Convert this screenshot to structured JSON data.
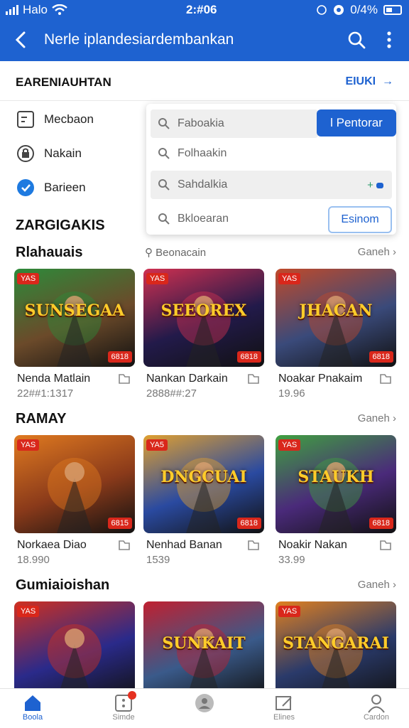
{
  "status_bar": {
    "carrier": "Halo",
    "time": "2:#06",
    "battery_text": "0/4%"
  },
  "app_bar": {
    "back_icon": "back-arrow-icon",
    "title": "Nerle iplandesiardembankan"
  },
  "section": {
    "label": "EARENIAUHTAN",
    "link": "EIUKI",
    "link_icon": "arrow-right-icon"
  },
  "side_list": [
    {
      "label": "Mecbaon",
      "icon": "document-icon"
    },
    {
      "label": "Nakain",
      "icon": "lock-icon"
    },
    {
      "label": "Barieen",
      "icon": "shield-icon"
    }
  ],
  "dropdown": {
    "rows": [
      {
        "text": "Faboakia"
      },
      {
        "text": "Folhaakin"
      },
      {
        "text": "Sahdalkia"
      },
      {
        "text": "Bkloearan"
      }
    ],
    "primary_button": "l  Pentorar",
    "outline_button": "Esinom",
    "trail": "+"
  },
  "zarg_heading": "ZARGIGAKIS",
  "rows": [
    {
      "title": "Rlahauais",
      "mid": "Beonacain",
      "see_all": "Ganeh",
      "cards": [
        {
          "logo": "SUNSEGAA",
          "name": "Nenda Matlain",
          "meta": "22##1:1317",
          "tl": "YAS",
          "br": "6818",
          "bg": "#6b4a2a",
          "accent": "#2d8a3a"
        },
        {
          "logo": "SEEOREX",
          "name": "Nankan Darkain",
          "meta": "2888##:27",
          "tl": "YAS",
          "br": "6818",
          "bg": "#221a4a",
          "accent": "#d03050"
        },
        {
          "logo": "JHACAN",
          "name": "Noakar Pnakaim",
          "meta": "19.96",
          "tl": "YAS",
          "br": "6818",
          "bg": "#3a4a7a",
          "accent": "#c04a2a"
        }
      ]
    },
    {
      "title": "RAMAY",
      "mid": "",
      "see_all": "Ganeh",
      "cards": [
        {
          "logo": "",
          "name": "Norkaea Diao",
          "meta": "18.990",
          "tl": "YAS",
          "br": "6815",
          "bg": "#8a3a1a",
          "accent": "#e07a20"
        },
        {
          "logo": "DNGCUAI",
          "name": "Nenhad Banan",
          "meta": "1539",
          "tl": "YA5",
          "br": "6818",
          "bg": "#2a4aa0",
          "accent": "#e0a030"
        },
        {
          "logo": "STAUKH",
          "name": "Noakir Nakan",
          "meta": "33.99",
          "tl": "YAS",
          "br": "6818",
          "bg": "#4a2a7a",
          "accent": "#40a040"
        }
      ]
    },
    {
      "title": "Gumiaioishan",
      "mid": "",
      "see_all": "Ganeh",
      "cards": [
        {
          "logo": "",
          "name": "",
          "meta": "",
          "tl": "YAS",
          "br": "",
          "bg": "#2a2a8a",
          "accent": "#d03020"
        },
        {
          "logo": "SUNKAIT",
          "name": "",
          "meta": "",
          "tl": "",
          "br": "",
          "bg": "#3a5a8a",
          "accent": "#c02030"
        },
        {
          "logo": "STANGARAI",
          "name": "",
          "meta": "",
          "tl": "YAS",
          "br": "",
          "bg": "#2a3a6a",
          "accent": "#e08020"
        }
      ]
    }
  ],
  "bottom_nav": [
    {
      "label": "Boola",
      "icon": "home-icon",
      "active": true
    },
    {
      "label": "Simde",
      "icon": "dice-icon",
      "active": false,
      "badge": true
    },
    {
      "label": "",
      "icon": "profile-icon",
      "active": false
    },
    {
      "label": "Elines",
      "icon": "edit-icon",
      "active": false
    },
    {
      "label": "Cardon",
      "icon": "user-icon",
      "active": false
    }
  ]
}
